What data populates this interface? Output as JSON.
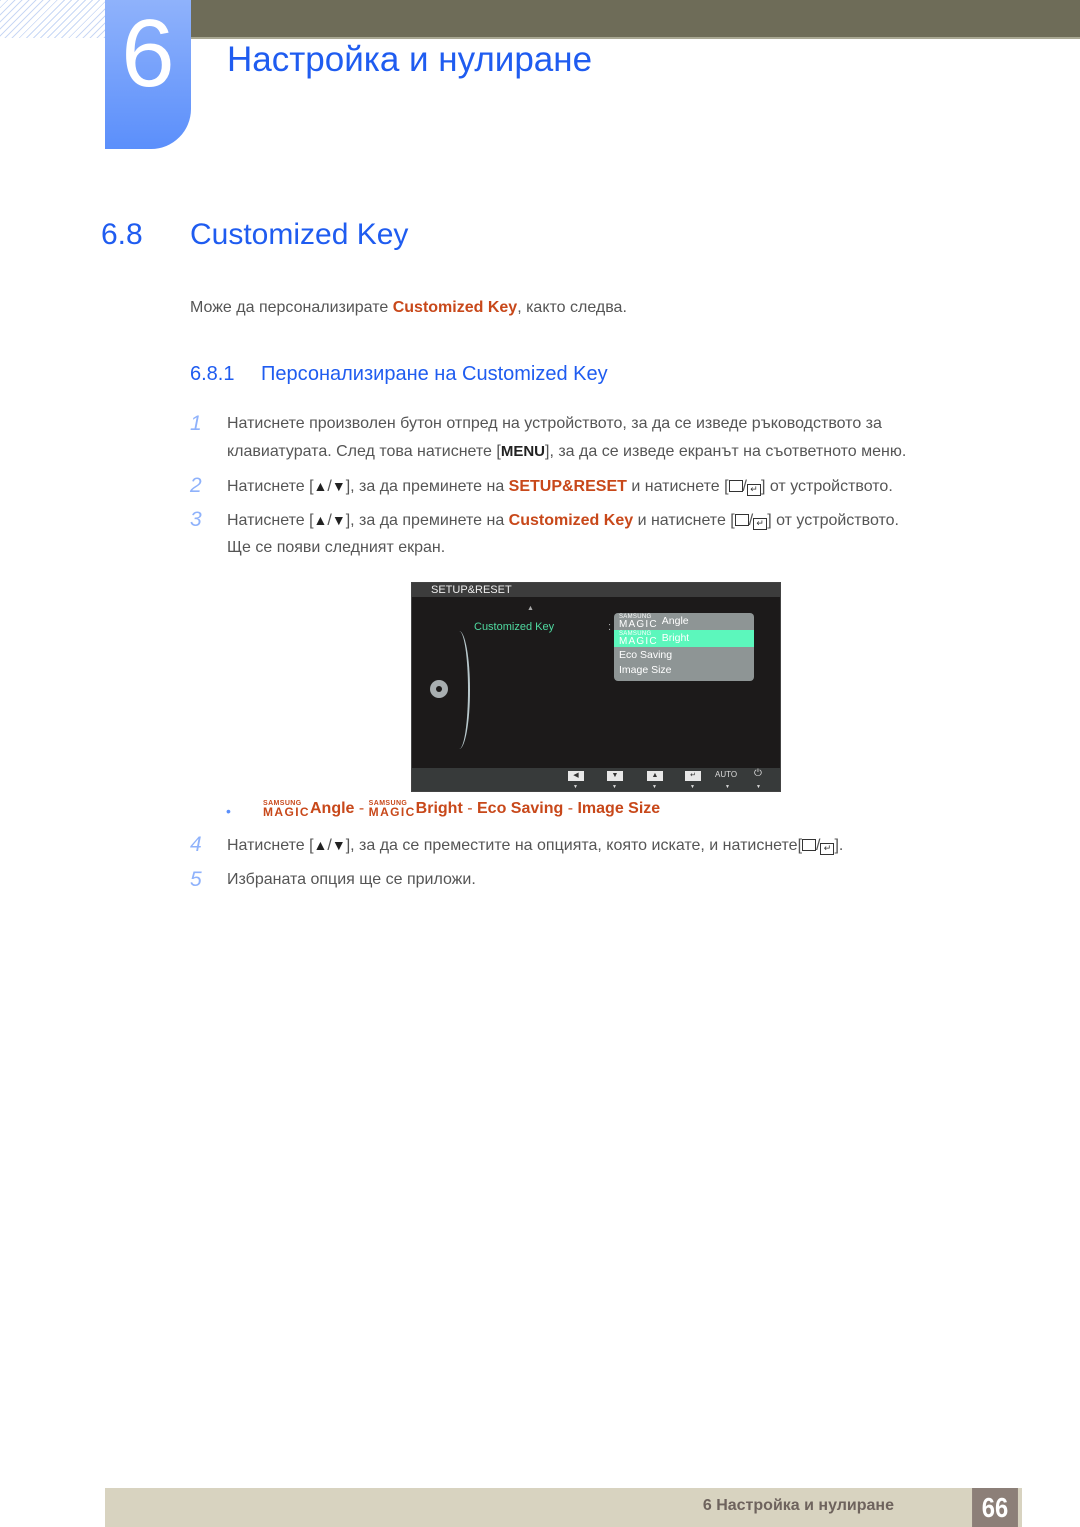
{
  "header": {
    "chapter_number": "6",
    "chapter_title": "Настройка и нулиране"
  },
  "section": {
    "number": "6.8",
    "title": "Customized Key",
    "intro_before": "Може да персонализирате ",
    "intro_highlight": "Customized Key",
    "intro_after": ", както следва."
  },
  "subsection": {
    "number": "6.8.1",
    "title": "Персонализиране на Customized Key"
  },
  "steps": [
    {
      "n": "1",
      "line1": "Натиснете произволен бутон отпред на устройството, за да се изведе ръководството за",
      "line2_before": "клавиатурата. След това натиснете [",
      "key": "MENU",
      "line2_after": "], за да се изведе екранът на съответното меню."
    },
    {
      "n": "2",
      "before": "Натиснете [",
      "mid": "], за да преминете на ",
      "highlight": "SETUP&RESET",
      "after_hl": " и натиснете [",
      "end": "] от устройството."
    },
    {
      "n": "3",
      "before": "Натиснете [",
      "mid": "], за да преминете на ",
      "highlight": "Customized Key",
      "after_hl": " и натиснете [",
      "end": "] от устройството.",
      "line2": "Ще се появи следният екран."
    },
    {
      "n": "4",
      "before": "Натиснете [",
      "mid": "], за да се преместите на опцията, която искате, и натиснете[",
      "end": "]."
    },
    {
      "n": "5",
      "text": "Избраната опция ще се приложи."
    }
  ],
  "icons": {
    "up": "▲",
    "down": "▼",
    "slash": "/",
    "enter": "↵"
  },
  "osd": {
    "title": "SETUP&RESET",
    "item": "Customized Key",
    "colon": ":",
    "brand_small": "SAMSUNG",
    "brand_magic": "MAGIC",
    "options": [
      {
        "magic": true,
        "label": "Angle",
        "selected": false
      },
      {
        "magic": true,
        "label": "Bright",
        "selected": true
      },
      {
        "magic": false,
        "label": "Eco Saving",
        "selected": false
      },
      {
        "magic": false,
        "label": "Image Size",
        "selected": false
      }
    ],
    "buttons": [
      "◀",
      "▼",
      "▲",
      "↵",
      "AUTO",
      "⏻"
    ],
    "accent_color": "#5cf7bc"
  },
  "bullet": {
    "brand_small": "SAMSUNG",
    "brand_magic": "MAGIC",
    "opt1": "Angle",
    "sep": " - ",
    "opt2": "Bright",
    "opt3": "Eco Saving",
    "opt4": "Image Size"
  },
  "footer": {
    "text": "6 Настройка и нулиране",
    "page": "66"
  },
  "colors": {
    "heading_blue": "#1f5cf0",
    "highlight_orange": "#c8481a",
    "header_bar": "#6e6c58",
    "footer_bar": "#d8d3c0",
    "page_box": "#8c7f78"
  }
}
